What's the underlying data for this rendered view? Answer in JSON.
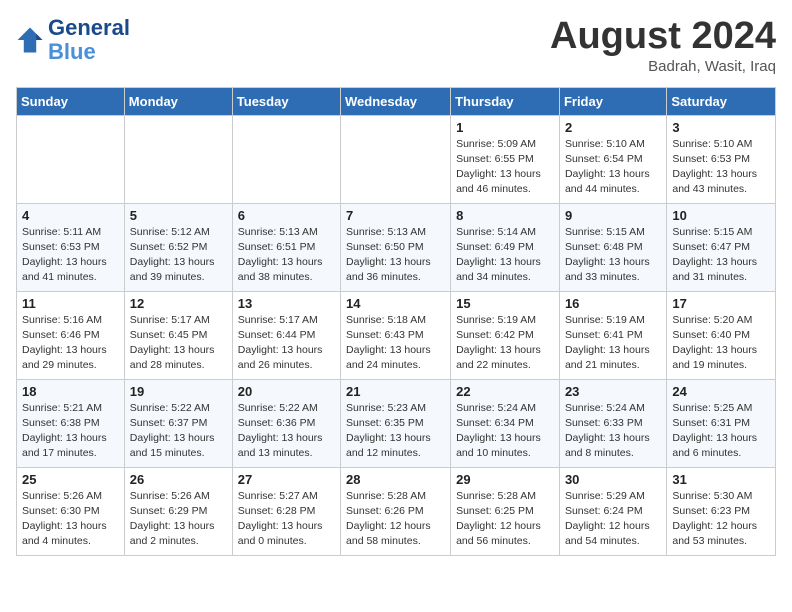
{
  "header": {
    "logo_line1": "General",
    "logo_line2": "Blue",
    "month": "August 2024",
    "location": "Badrah, Wasit, Iraq"
  },
  "days_of_week": [
    "Sunday",
    "Monday",
    "Tuesday",
    "Wednesday",
    "Thursday",
    "Friday",
    "Saturday"
  ],
  "weeks": [
    [
      {
        "day": "",
        "sunrise": "",
        "sunset": "",
        "daylight": ""
      },
      {
        "day": "",
        "sunrise": "",
        "sunset": "",
        "daylight": ""
      },
      {
        "day": "",
        "sunrise": "",
        "sunset": "",
        "daylight": ""
      },
      {
        "day": "",
        "sunrise": "",
        "sunset": "",
        "daylight": ""
      },
      {
        "day": "1",
        "sunrise": "Sunrise: 5:09 AM",
        "sunset": "Sunset: 6:55 PM",
        "daylight": "Daylight: 13 hours and 46 minutes."
      },
      {
        "day": "2",
        "sunrise": "Sunrise: 5:10 AM",
        "sunset": "Sunset: 6:54 PM",
        "daylight": "Daylight: 13 hours and 44 minutes."
      },
      {
        "day": "3",
        "sunrise": "Sunrise: 5:10 AM",
        "sunset": "Sunset: 6:53 PM",
        "daylight": "Daylight: 13 hours and 43 minutes."
      }
    ],
    [
      {
        "day": "4",
        "sunrise": "Sunrise: 5:11 AM",
        "sunset": "Sunset: 6:53 PM",
        "daylight": "Daylight: 13 hours and 41 minutes."
      },
      {
        "day": "5",
        "sunrise": "Sunrise: 5:12 AM",
        "sunset": "Sunset: 6:52 PM",
        "daylight": "Daylight: 13 hours and 39 minutes."
      },
      {
        "day": "6",
        "sunrise": "Sunrise: 5:13 AM",
        "sunset": "Sunset: 6:51 PM",
        "daylight": "Daylight: 13 hours and 38 minutes."
      },
      {
        "day": "7",
        "sunrise": "Sunrise: 5:13 AM",
        "sunset": "Sunset: 6:50 PM",
        "daylight": "Daylight: 13 hours and 36 minutes."
      },
      {
        "day": "8",
        "sunrise": "Sunrise: 5:14 AM",
        "sunset": "Sunset: 6:49 PM",
        "daylight": "Daylight: 13 hours and 34 minutes."
      },
      {
        "day": "9",
        "sunrise": "Sunrise: 5:15 AM",
        "sunset": "Sunset: 6:48 PM",
        "daylight": "Daylight: 13 hours and 33 minutes."
      },
      {
        "day": "10",
        "sunrise": "Sunrise: 5:15 AM",
        "sunset": "Sunset: 6:47 PM",
        "daylight": "Daylight: 13 hours and 31 minutes."
      }
    ],
    [
      {
        "day": "11",
        "sunrise": "Sunrise: 5:16 AM",
        "sunset": "Sunset: 6:46 PM",
        "daylight": "Daylight: 13 hours and 29 minutes."
      },
      {
        "day": "12",
        "sunrise": "Sunrise: 5:17 AM",
        "sunset": "Sunset: 6:45 PM",
        "daylight": "Daylight: 13 hours and 28 minutes."
      },
      {
        "day": "13",
        "sunrise": "Sunrise: 5:17 AM",
        "sunset": "Sunset: 6:44 PM",
        "daylight": "Daylight: 13 hours and 26 minutes."
      },
      {
        "day": "14",
        "sunrise": "Sunrise: 5:18 AM",
        "sunset": "Sunset: 6:43 PM",
        "daylight": "Daylight: 13 hours and 24 minutes."
      },
      {
        "day": "15",
        "sunrise": "Sunrise: 5:19 AM",
        "sunset": "Sunset: 6:42 PM",
        "daylight": "Daylight: 13 hours and 22 minutes."
      },
      {
        "day": "16",
        "sunrise": "Sunrise: 5:19 AM",
        "sunset": "Sunset: 6:41 PM",
        "daylight": "Daylight: 13 hours and 21 minutes."
      },
      {
        "day": "17",
        "sunrise": "Sunrise: 5:20 AM",
        "sunset": "Sunset: 6:40 PM",
        "daylight": "Daylight: 13 hours and 19 minutes."
      }
    ],
    [
      {
        "day": "18",
        "sunrise": "Sunrise: 5:21 AM",
        "sunset": "Sunset: 6:38 PM",
        "daylight": "Daylight: 13 hours and 17 minutes."
      },
      {
        "day": "19",
        "sunrise": "Sunrise: 5:22 AM",
        "sunset": "Sunset: 6:37 PM",
        "daylight": "Daylight: 13 hours and 15 minutes."
      },
      {
        "day": "20",
        "sunrise": "Sunrise: 5:22 AM",
        "sunset": "Sunset: 6:36 PM",
        "daylight": "Daylight: 13 hours and 13 minutes."
      },
      {
        "day": "21",
        "sunrise": "Sunrise: 5:23 AM",
        "sunset": "Sunset: 6:35 PM",
        "daylight": "Daylight: 13 hours and 12 minutes."
      },
      {
        "day": "22",
        "sunrise": "Sunrise: 5:24 AM",
        "sunset": "Sunset: 6:34 PM",
        "daylight": "Daylight: 13 hours and 10 minutes."
      },
      {
        "day": "23",
        "sunrise": "Sunrise: 5:24 AM",
        "sunset": "Sunset: 6:33 PM",
        "daylight": "Daylight: 13 hours and 8 minutes."
      },
      {
        "day": "24",
        "sunrise": "Sunrise: 5:25 AM",
        "sunset": "Sunset: 6:31 PM",
        "daylight": "Daylight: 13 hours and 6 minutes."
      }
    ],
    [
      {
        "day": "25",
        "sunrise": "Sunrise: 5:26 AM",
        "sunset": "Sunset: 6:30 PM",
        "daylight": "Daylight: 13 hours and 4 minutes."
      },
      {
        "day": "26",
        "sunrise": "Sunrise: 5:26 AM",
        "sunset": "Sunset: 6:29 PM",
        "daylight": "Daylight: 13 hours and 2 minutes."
      },
      {
        "day": "27",
        "sunrise": "Sunrise: 5:27 AM",
        "sunset": "Sunset: 6:28 PM",
        "daylight": "Daylight: 13 hours and 0 minutes."
      },
      {
        "day": "28",
        "sunrise": "Sunrise: 5:28 AM",
        "sunset": "Sunset: 6:26 PM",
        "daylight": "Daylight: 12 hours and 58 minutes."
      },
      {
        "day": "29",
        "sunrise": "Sunrise: 5:28 AM",
        "sunset": "Sunset: 6:25 PM",
        "daylight": "Daylight: 12 hours and 56 minutes."
      },
      {
        "day": "30",
        "sunrise": "Sunrise: 5:29 AM",
        "sunset": "Sunset: 6:24 PM",
        "daylight": "Daylight: 12 hours and 54 minutes."
      },
      {
        "day": "31",
        "sunrise": "Sunrise: 5:30 AM",
        "sunset": "Sunset: 6:23 PM",
        "daylight": "Daylight: 12 hours and 53 minutes."
      }
    ]
  ]
}
